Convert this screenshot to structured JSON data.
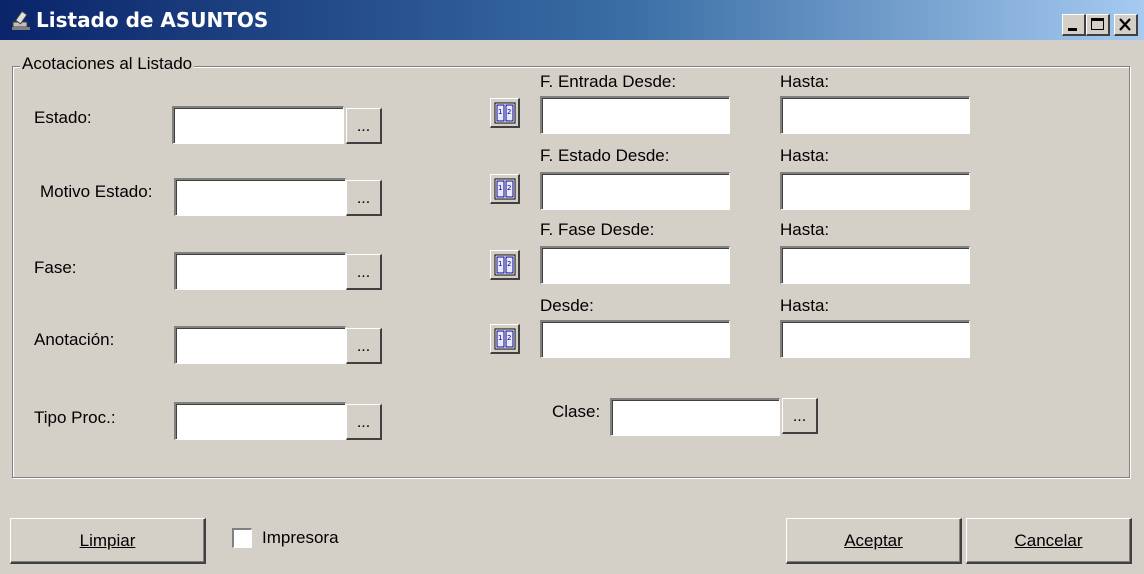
{
  "window": {
    "title": "Listado de ASUNTOS",
    "icon": "gavel-icon",
    "controls": [
      "minimize",
      "maximize",
      "close"
    ]
  },
  "group": {
    "label": "Acotaciones al Listado"
  },
  "left_fields": [
    {
      "label": "Estado:",
      "value": "",
      "button": "..."
    },
    {
      "label": "Motivo Estado:",
      "value": "",
      "button": "..."
    },
    {
      "label": "Fase:",
      "value": "",
      "button": "..."
    },
    {
      "label": "Anotación:",
      "value": "",
      "button": "..."
    },
    {
      "label": "Tipo Proc.:",
      "value": "",
      "button": "..."
    }
  ],
  "date_ranges": [
    {
      "from_label": "F. Entrada Desde:",
      "to_label": "Hasta:",
      "from_value": "",
      "to_value": ""
    },
    {
      "from_label": "F. Estado Desde:",
      "to_label": "Hasta:",
      "from_value": "",
      "to_value": ""
    },
    {
      "from_label": "F. Fase Desde:",
      "to_label": "Hasta:",
      "from_value": "",
      "to_value": ""
    },
    {
      "from_label": "Desde:",
      "to_label": "Hasta:",
      "from_value": "",
      "to_value": ""
    }
  ],
  "clase": {
    "label": "Clase:",
    "value": "",
    "button": "..."
  },
  "footer": {
    "clear_label": "Limpiar",
    "printer_label": "Impresora",
    "printer_checked": false,
    "accept_label": "Aceptar",
    "cancel_label": "Cancelar"
  }
}
